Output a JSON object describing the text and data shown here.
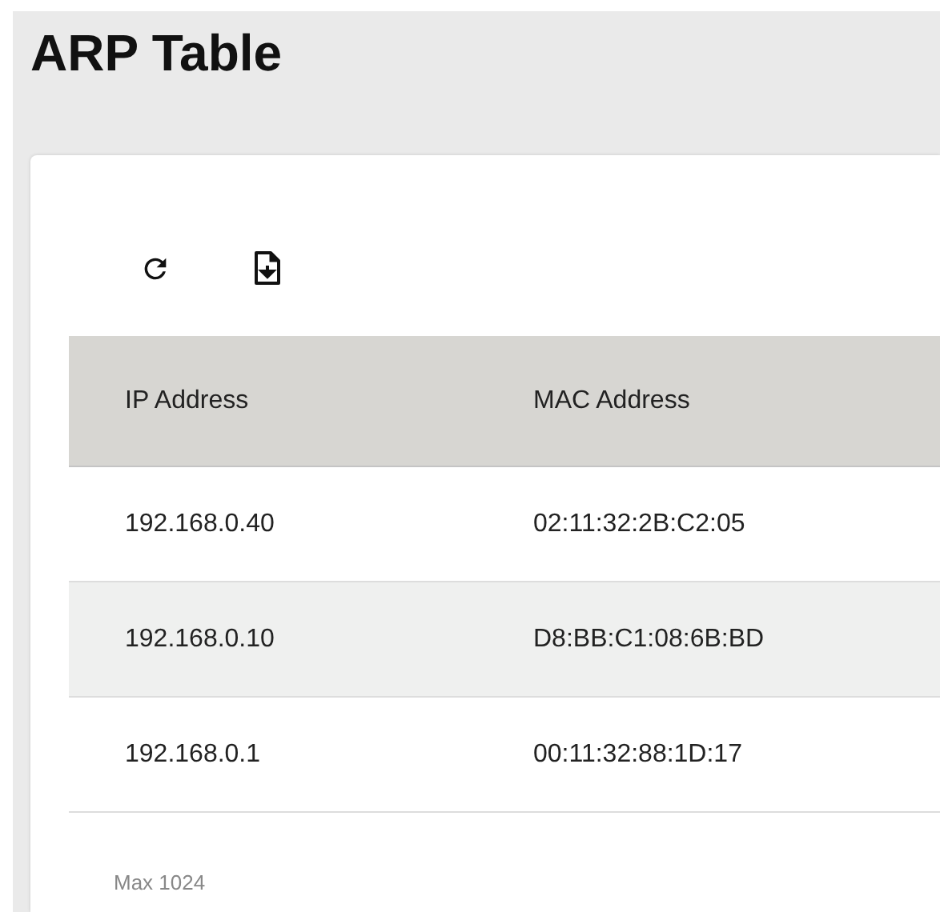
{
  "title": "ARP Table",
  "toolbar": [
    {
      "kind": "refresh"
    },
    {
      "kind": "export"
    }
  ],
  "table": {
    "columns": [
      "IP Address",
      "MAC Address"
    ],
    "rows": [
      [
        "192.168.0.40",
        "02:11:32:2B:C2:05"
      ],
      [
        "192.168.0.10",
        "D8:BB:C1:08:6B:BD"
      ],
      [
        "192.168.0.1",
        "00:11:32:88:1D:17"
      ]
    ]
  },
  "footer": "Max 1024"
}
